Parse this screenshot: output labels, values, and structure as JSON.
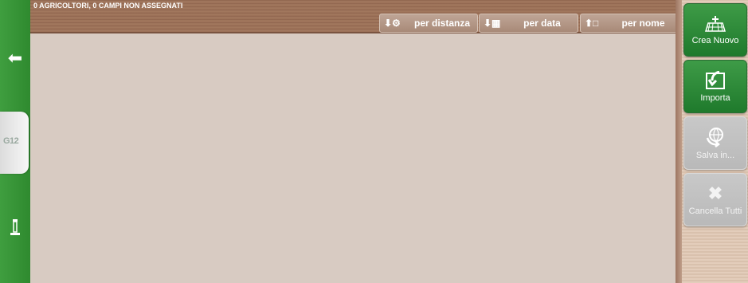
{
  "header": {
    "counts": "0 AGRICOLTORI, 0 CAMPI NON ASSEGNATI"
  },
  "sort": {
    "distance_label": "per distanza",
    "date_label": "per data",
    "name_label": "per nome"
  },
  "sidebar": {
    "tab_label": "G12"
  },
  "actions": {
    "create_label": "Crea Nuovo",
    "import_label": "Importa",
    "save_label": "Salva in...",
    "delete_label": "Cancella Tutti"
  },
  "icons": {
    "back": "arrow-left-icon",
    "pump": "pump-icon",
    "sort_distance": "tractor-icon",
    "sort_date": "calendar-icon",
    "sort_name": "alphabet-icon",
    "create": "add-field-icon",
    "import": "import-icon",
    "save": "globe-save-icon",
    "delete": "close-icon"
  },
  "colors": {
    "green": "#2f8a2f",
    "wood": "#9a6e55",
    "background": "#d8cbc2"
  }
}
